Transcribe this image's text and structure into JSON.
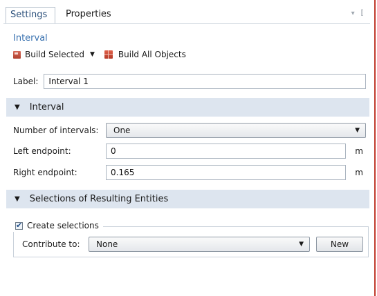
{
  "tabs": [
    {
      "label": "Settings",
      "active": true
    },
    {
      "label": "Properties",
      "active": false
    }
  ],
  "panel_controls": [
    "chevron-down-icon",
    "pin-icon"
  ],
  "heading": "Interval",
  "toolbar": {
    "build_selected": "Build Selected",
    "build_all": "Build All Objects"
  },
  "label_field": {
    "label": "Label:",
    "value": "Interval 1"
  },
  "sections": {
    "interval": "Interval",
    "selections": "Selections of Resulting Entities"
  },
  "interval": {
    "num_intervals_label": "Number of intervals:",
    "num_intervals_value": "One",
    "left_label": "Left endpoint:",
    "left_value": "0",
    "left_unit": "m",
    "right_label": "Right endpoint:",
    "right_value": "0.165",
    "right_unit": "m"
  },
  "selections": {
    "create_label": "Create selections",
    "create_checked": true,
    "contribute_label": "Contribute to:",
    "contribute_value": "None",
    "new_button": "New"
  },
  "colors": {
    "accent_text": "#3a72b0",
    "section_bg": "#dde5ef",
    "panel_border": "#c0392b"
  }
}
